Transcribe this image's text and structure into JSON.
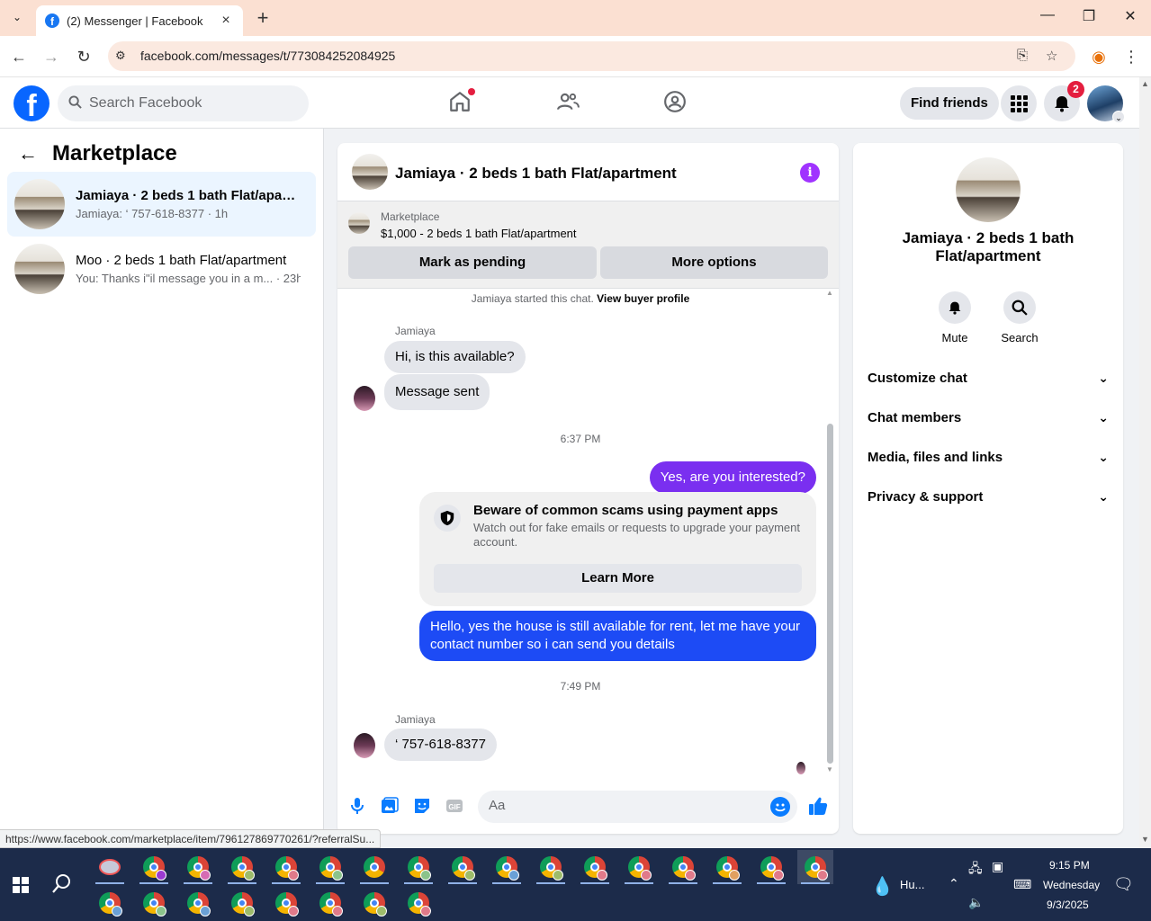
{
  "browser": {
    "tab_title": "(2) Messenger | Facebook",
    "url": "facebook.com/messages/t/773084252084925",
    "status_url": "https://www.facebook.com/marketplace/item/796127869770261/?referralSu..."
  },
  "fb_nav": {
    "search_placeholder": "Search Facebook",
    "find_friends": "Find friends",
    "notification_count": "2"
  },
  "sidebar": {
    "title": "Marketplace",
    "conversations": [
      {
        "name": "Jamiaya · 2 beds 1 bath Flat/apart...",
        "snippet": "Jamiaya: ‘ 757-618-8377 · 1h",
        "active": true
      },
      {
        "name": "Moo · 2 beds 1 bath Flat/apartment",
        "snippet": "You: Thanks i\"il message you in a m...   · 23h",
        "active": false
      }
    ]
  },
  "chat": {
    "title": "Jamiaya · 2 beds 1 bath Flat/apartment",
    "marketplace_label": "Marketplace",
    "listing": "$1,000 - 2 beds 1 bath Flat/apartment",
    "mark_pending": "Mark as pending",
    "more_options": "More options",
    "system_line": "Jamiaya started this chat.",
    "view_buyer_profile": "View buyer profile",
    "sender_name": "Jamiaya",
    "msg_1": "Hi, is this available?",
    "msg_2": "Message sent",
    "time_1": "6:37 PM",
    "msg_3": "Yes, are you interested?",
    "scam_title": "Beware of common scams using payment apps",
    "scam_body": "Watch out for fake emails or requests to upgrade your payment account.",
    "learn_more": "Learn More",
    "msg_4": "Hello, yes the house is still available for rent, let me have your contact number so i can send you details",
    "time_2": "7:49 PM",
    "sender_name_2": "Jamiaya",
    "msg_5": "‘ 757-618-8377",
    "composer_placeholder": "Aa"
  },
  "right_panel": {
    "title": "Jamiaya · 2 beds 1 bath Flat/apartment",
    "mute": "Mute",
    "search": "Search",
    "rows": [
      "Customize chat",
      "Chat members",
      "Media, files and links",
      "Privacy & support"
    ]
  },
  "taskbar": {
    "weather": "Hu...",
    "time": "9:15 PM",
    "day": "Wednesday",
    "date": "9/3/2025"
  },
  "colors": {
    "fb_blue": "#0866ff",
    "outgoing_purple": "#7a2ff0",
    "outgoing_blue": "#1d4bf5",
    "info_purple": "#a033ff"
  }
}
